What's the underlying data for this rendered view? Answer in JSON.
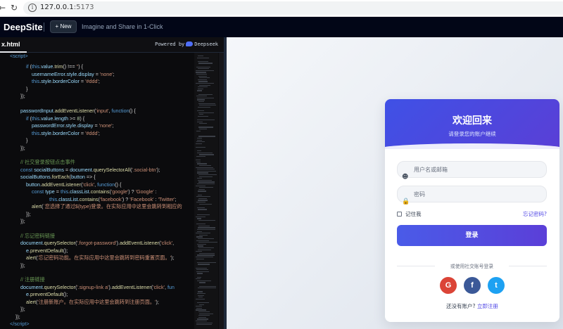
{
  "browser": {
    "back": "←",
    "reload": "↻",
    "info": "i",
    "url_host": "127.0.0.1",
    "url_port": ":5173"
  },
  "app": {
    "logo": "DeepSite",
    "new_button": "+ New",
    "tagline": "Imagine and Share in 1-Click"
  },
  "editor": {
    "file_tab": "x.html",
    "powered_by": "Powered by",
    "powered_brand": "Deepseek"
  },
  "preview": {
    "title": "欢迎回来",
    "subtitle": "请登录您的账户继续",
    "username_placeholder": "用户名或邮箱",
    "password_placeholder": "密码",
    "remember_me": "记住我",
    "forgot_password": "忘记密码?",
    "login_button": "登录",
    "or_text": "或使用社交账号登录",
    "social": [
      {
        "letter": "G",
        "name": "google",
        "color": "#db4437"
      },
      {
        "letter": "f",
        "name": "facebook",
        "color": "#3b5998"
      },
      {
        "letter": "t",
        "name": "twitter",
        "color": "#1da1f2"
      }
    ],
    "signup_prompt": "还没有账户?",
    "signup_link": "立即注册"
  },
  "colors": {
    "accent": "#4f46e5",
    "header_start": "#3f51e6",
    "header_end": "#5a3fd6",
    "editor_bg": "#0b0b0d",
    "topbar_bg": "#020617"
  }
}
